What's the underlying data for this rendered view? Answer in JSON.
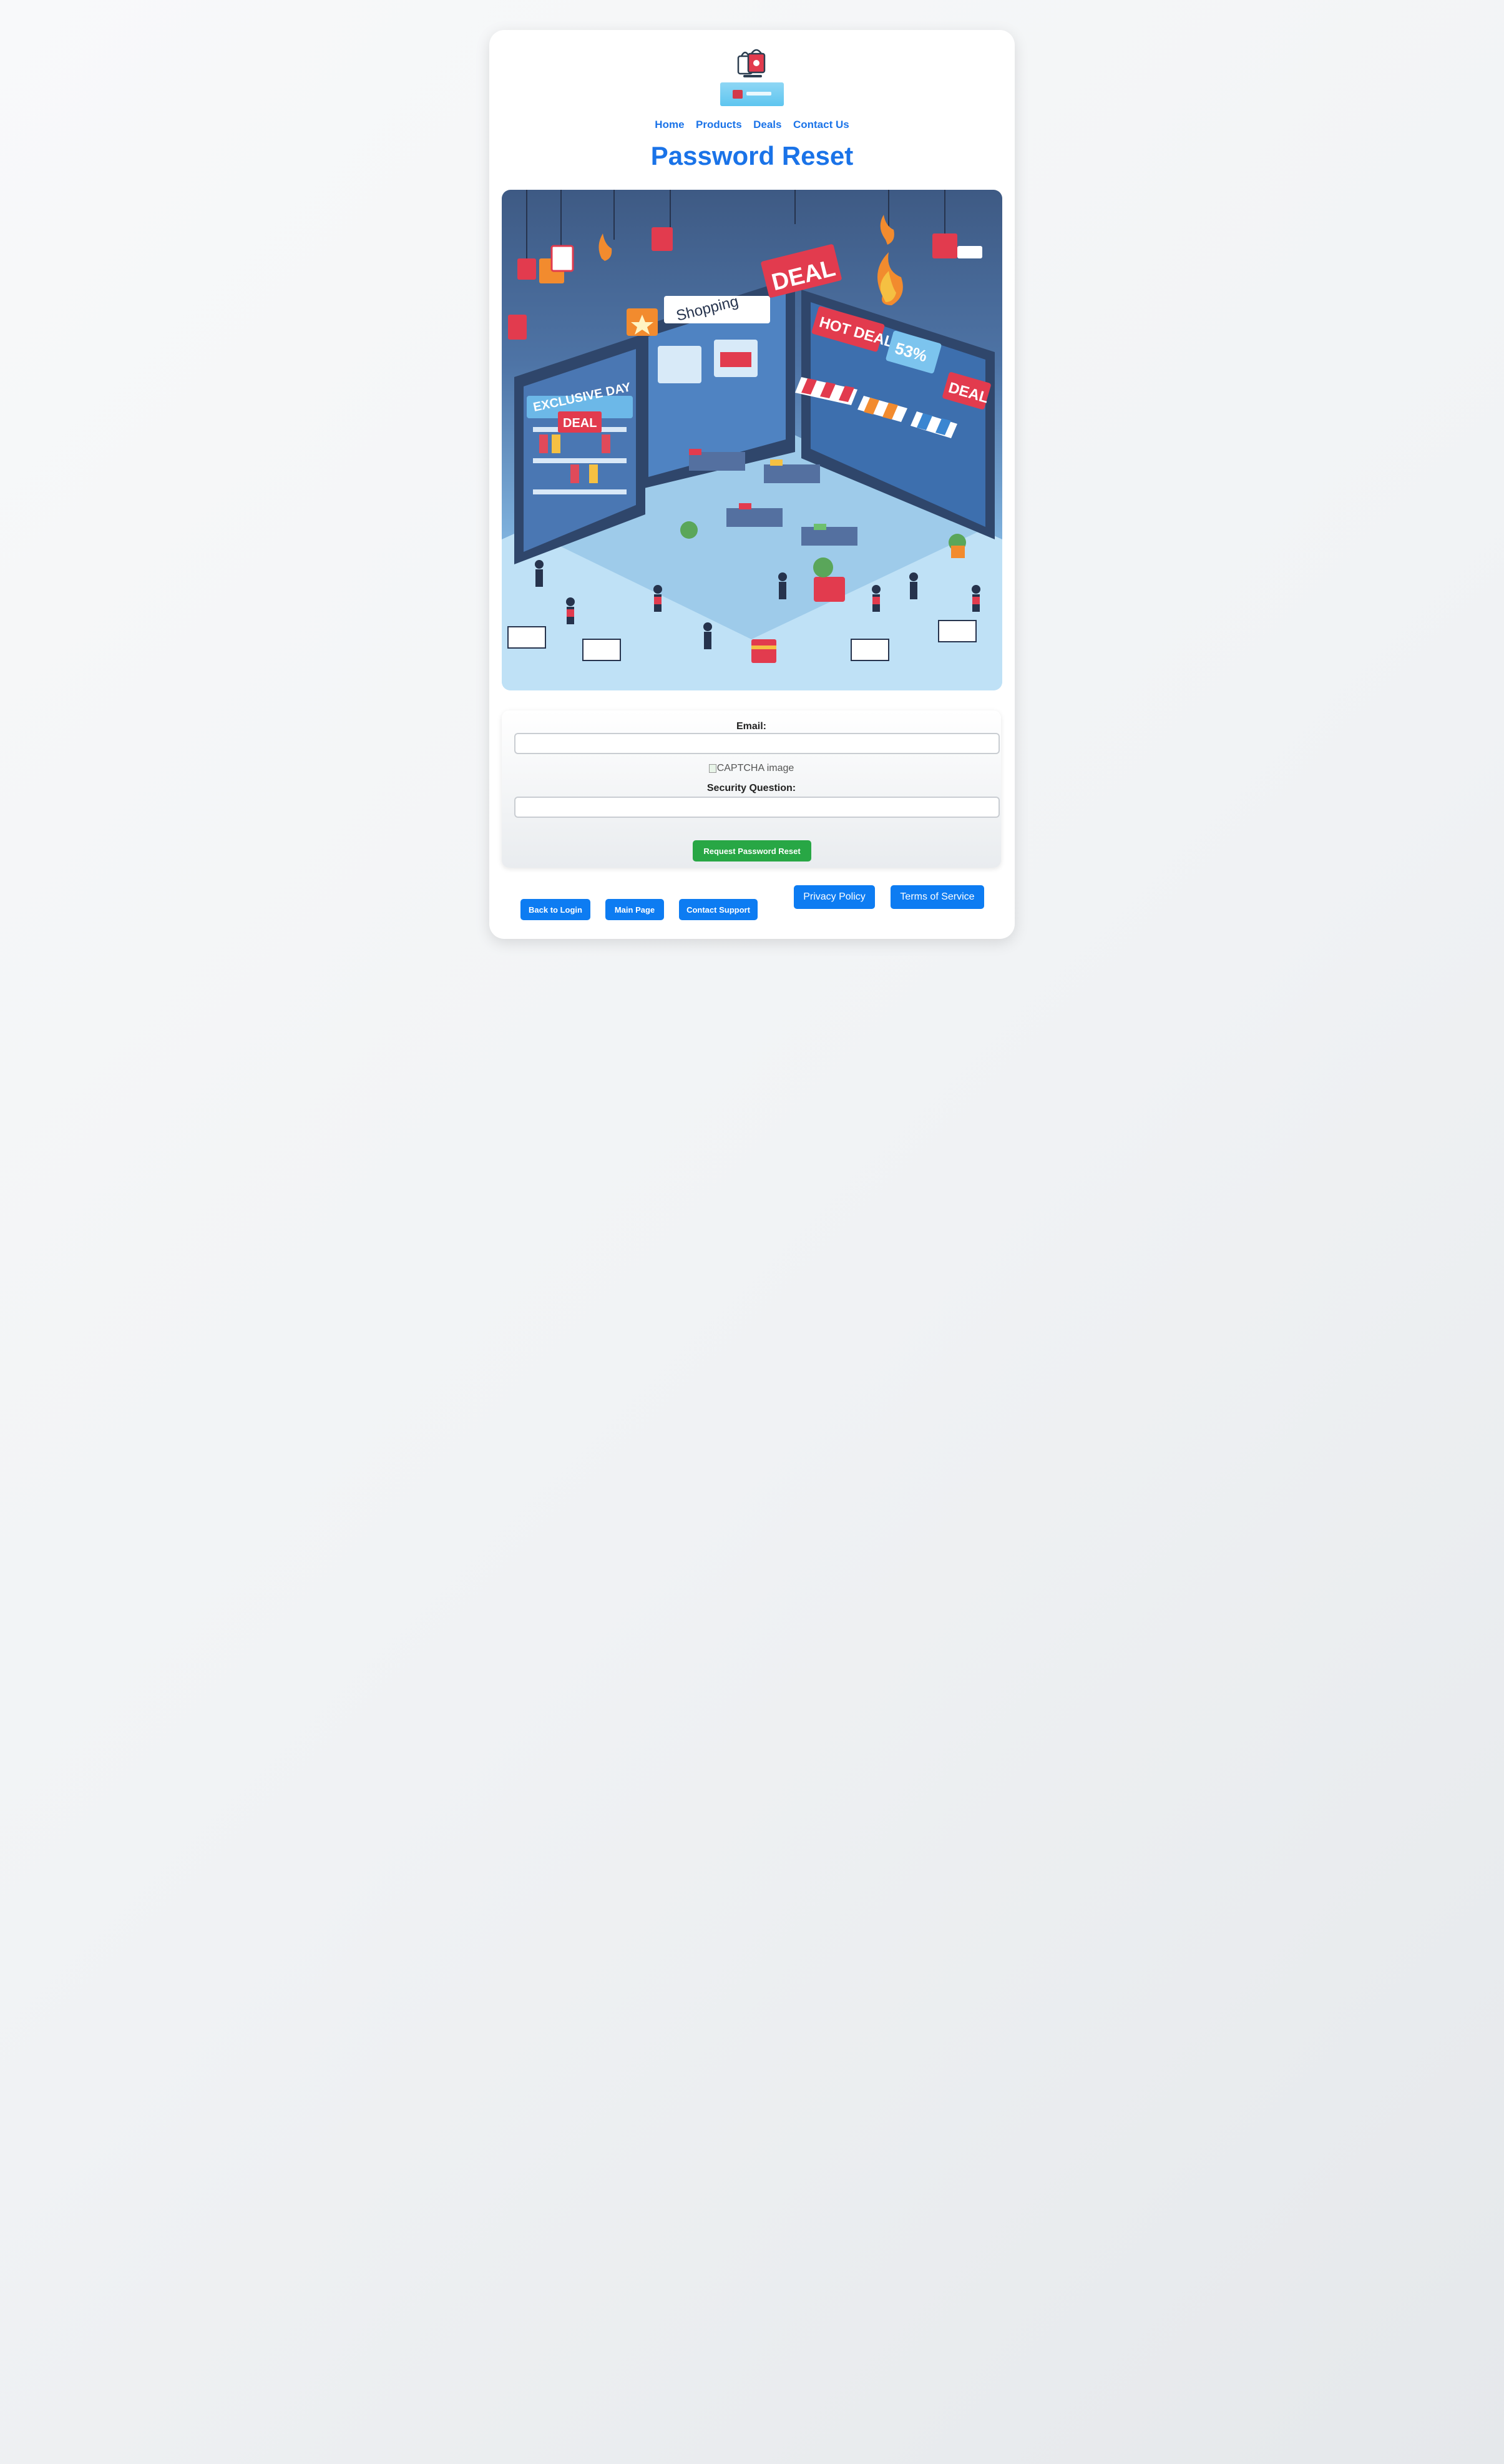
{
  "nav": {
    "items": [
      "Home",
      "Products",
      "Deals",
      "Contact Us"
    ]
  },
  "page_title": "Password Reset",
  "hero": {
    "signs": [
      "DEAL",
      "Shopping",
      "HOT DEAL",
      "DEAL",
      "53%",
      "EXCLUSIVE DAY",
      "DEAL"
    ]
  },
  "form": {
    "email_label": "Email:",
    "email_value": "",
    "captcha_alt": "CAPTCHA image",
    "security_label": "Security Question:",
    "security_value": "",
    "submit_label": "Request Password Reset"
  },
  "footer_links": {
    "back_to_login": "Back to Login",
    "main_page": "Main Page",
    "contact_support": "Contact Support",
    "privacy_policy": "Privacy Policy",
    "terms_of_service": "Terms of Service"
  },
  "colors": {
    "accent": "#1a73e8",
    "button_blue": "#0d7cf2",
    "button_green": "#28a745"
  }
}
